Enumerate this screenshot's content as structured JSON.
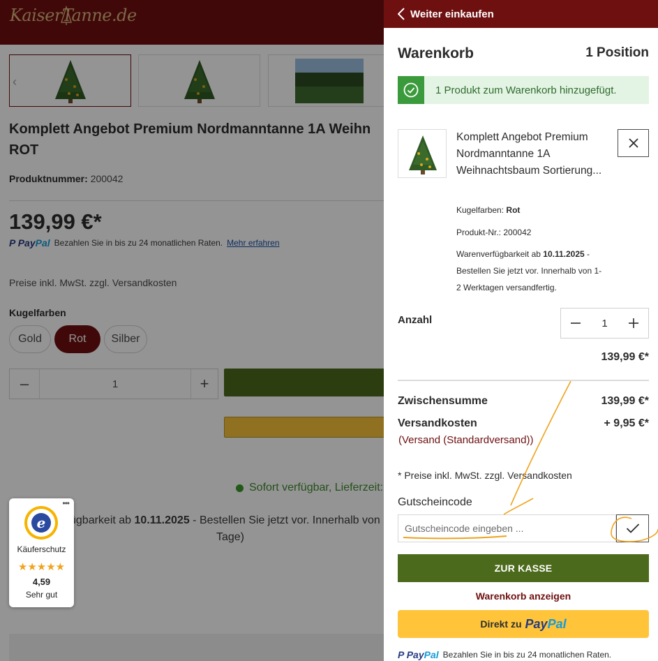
{
  "site": {
    "logo_text": "KaiserTanne.de"
  },
  "product_page": {
    "title": "Komplett Angebot Premium Nordmanntanne 1A Weihn\nROT",
    "product_number_label": "Produktnummer:",
    "product_number": "200042",
    "price": "139,99 €*",
    "paypal_text": "Bezahlen Sie in bis zu 24 monatlichen Raten.",
    "paypal_link": "Mehr erfahren",
    "tax_note": "Preise inkl. MwSt. zzgl. Versandkosten",
    "ball_colors_label": "Kugelfarben",
    "ball_colors": [
      "Gold",
      "Rot",
      "Silber"
    ],
    "selected_color": "Rot",
    "quantity": "1",
    "availability": "Sofort verfügbar, Lieferzeit:",
    "availability_detail_prefix": "ügbarkeit ab",
    "availability_date": "10.11.2025",
    "availability_detail_suffix": "- Bestellen Sie jetzt vor. Innerhalb von",
    "availability_detail_line2": "Tage)"
  },
  "trusted_shops": {
    "title": "Käuferschutz",
    "stars": "★★★★★",
    "rating": "4,59",
    "rating_label": "Sehr gut"
  },
  "cart": {
    "back_label": "Weiter einkaufen",
    "title": "Warenkorb",
    "count": "1 Position",
    "success_message": "1 Produkt zum Warenkorb hinzugefügt.",
    "item": {
      "name": "Komplett Angebot Premium Nordmanntanne 1A Weihnachtsbaum Sortierung...",
      "color_label": "Kugelfarben:",
      "color_value": "Rot",
      "number_label": "Produkt-Nr.:",
      "number_value": "200042",
      "stock_prefix": "Warenverfügbarkeit ab",
      "stock_date": "10.11.2025",
      "stock_suffix": "- Bestellen Sie jetzt vor. Innerhalb von 1-2 Werktagen versandfertig.",
      "quantity_label": "Anzahl",
      "quantity": "1",
      "line_price": "139,99 €*"
    },
    "subtotal_label": "Zwischensumme",
    "subtotal": "139,99 €*",
    "shipping_label": "Versandkosten",
    "shipping": "+ 9,95 €*",
    "shipping_method": "(Versand (Standardversand))",
    "vat_note": "* Preise inkl. MwSt. zzgl. Versandkosten",
    "coupon_label": "Gutscheincode",
    "coupon_placeholder": "Gutscheincode eingeben ...",
    "coupon_value": "",
    "checkout_label": "ZUR KASSE",
    "show_cart_label": "Warenkorb anzeigen",
    "paypal_button_prefix": "Direkt zu",
    "paypal_logo_a": "Pay",
    "paypal_logo_b": "Pal",
    "paypal_installments": "Bezahlen Sie in bis zu 24 monatlichen Raten."
  },
  "colors": {
    "brand": "#6e0f10",
    "checkout_green": "#4c6a1b",
    "success_green": "#3b9a3b",
    "paypal_yellow": "#ffc439",
    "annotation_orange": "#f0a21b"
  }
}
